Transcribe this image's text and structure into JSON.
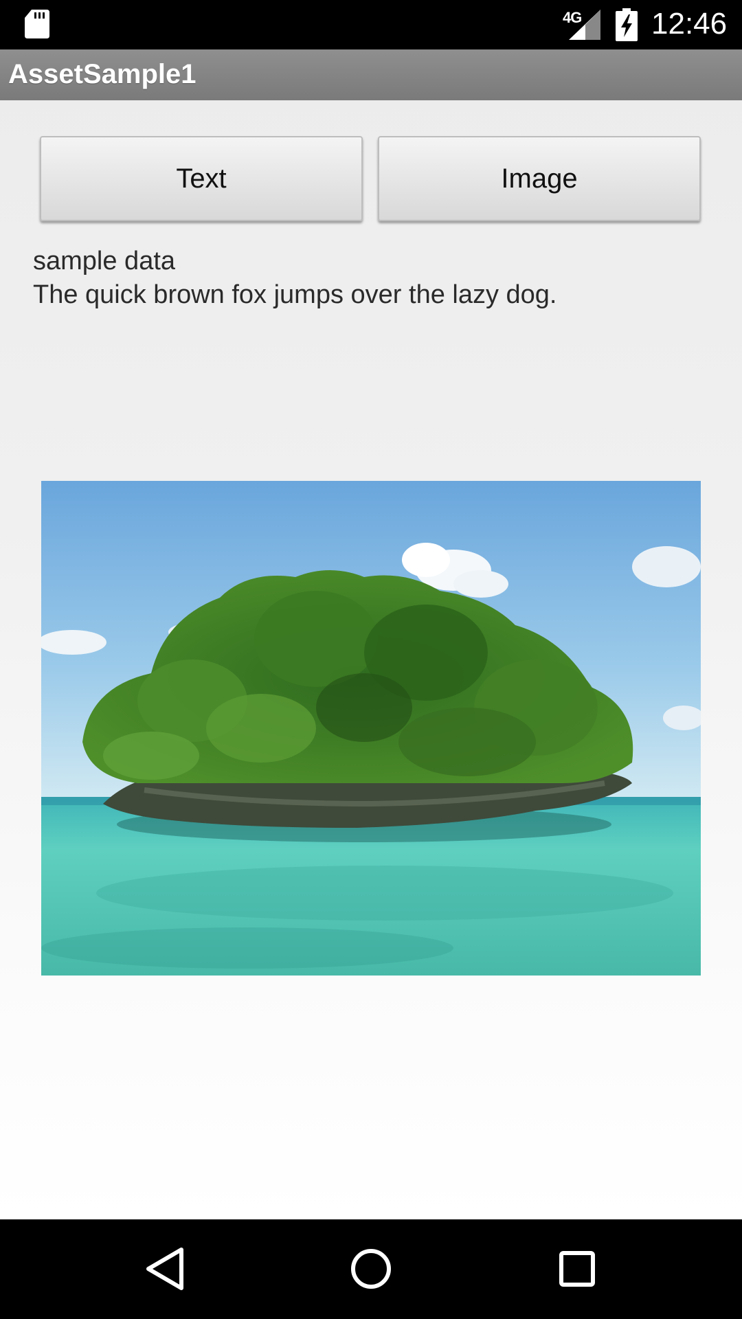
{
  "status_bar": {
    "time": "12:46",
    "network": "4G",
    "icons": [
      "sd-card-icon",
      "signal-icon",
      "battery-charging-icon"
    ]
  },
  "action_bar": {
    "title": "AssetSample1"
  },
  "buttons": {
    "text_label": "Text",
    "image_label": "Image"
  },
  "output": {
    "line1": "sample data",
    "line2": "The quick brown fox jumps over the lazy dog."
  },
  "image": {
    "subject": "rock-island-photo"
  },
  "nav_bar": {
    "icons": [
      "back-icon",
      "home-icon",
      "recents-icon"
    ]
  }
}
